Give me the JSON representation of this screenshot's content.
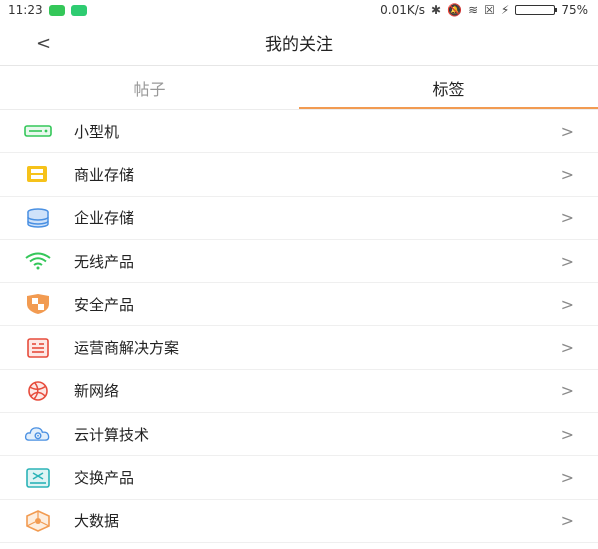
{
  "status": {
    "time": "11:23",
    "net_speed": "0.01K/s",
    "battery": "75%"
  },
  "header": {
    "back": "<",
    "title": "我的关注"
  },
  "tabs": [
    {
      "label": "帖子",
      "active": false
    },
    {
      "label": "标签",
      "active": true
    }
  ],
  "items": [
    {
      "label": "小型机",
      "icon": "server-icon",
      "color": "#34c759"
    },
    {
      "label": "商业存储",
      "icon": "storage-box-icon",
      "color": "#f6c21a"
    },
    {
      "label": "企业存储",
      "icon": "database-icon",
      "color": "#4a90e2"
    },
    {
      "label": "无线产品",
      "icon": "wifi-icon",
      "color": "#34c759"
    },
    {
      "label": "安全产品",
      "icon": "shield-icon",
      "color": "#f29b51"
    },
    {
      "label": "运营商解决方案",
      "icon": "carrier-icon",
      "color": "#e74c3c"
    },
    {
      "label": "新网络",
      "icon": "network-icon",
      "color": "#e74c3c"
    },
    {
      "label": "云计算技术",
      "icon": "cloud-gear-icon",
      "color": "#4a90e2"
    },
    {
      "label": "交换产品",
      "icon": "switch-icon",
      "color": "#2bb3b7"
    },
    {
      "label": "大数据",
      "icon": "bigdata-icon",
      "color": "#f29b51"
    }
  ],
  "chevron": ">"
}
